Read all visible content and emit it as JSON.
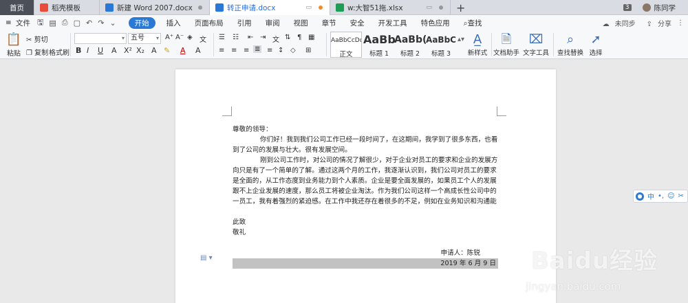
{
  "tabs": [
    {
      "label": "首页"
    },
    {
      "label": "稻壳模板",
      "icon": "docer-icon",
      "color": "#e84b3c"
    },
    {
      "label": "新建 Word 2007.docx",
      "icon": "word-doc-icon",
      "color": "#2b79d6"
    },
    {
      "label": "转正申请.docx",
      "icon": "word-doc-icon",
      "color": "#2b79d6"
    },
    {
      "label": "w:大智51拖.xlsx",
      "icon": "excel-icon",
      "color": "#1f9d55"
    }
  ],
  "tabbar_right": {
    "badge": "3",
    "user": "陈同学"
  },
  "menu": {
    "file": "文件",
    "start": "开始",
    "items": [
      "插入",
      "页面布局",
      "引用",
      "审阅",
      "视图",
      "章节",
      "安全",
      "开发工具",
      "特色应用"
    ],
    "search": "查找",
    "right": [
      "未同步",
      "分享"
    ]
  },
  "ribbon": {
    "paste": "粘贴",
    "cut": "剪切",
    "copy": "复制",
    "format_painter": "格式刷",
    "font_name": "",
    "font_size": "五号",
    "styles": [
      {
        "sample": "AaBbCcDd",
        "label": "正文"
      },
      {
        "sample": "AaBb",
        "label": "标题 1"
      },
      {
        "sample": "AaBb(",
        "label": "标题 2"
      },
      {
        "sample": "AaBbC",
        "label": "标题 3"
      }
    ],
    "new_style": "新样式",
    "doc_helper": "文档助手",
    "text_tools": "文字工具",
    "find_replace": "查找替换",
    "select": "选择"
  },
  "document": {
    "salutation": "尊敬的领导：",
    "para1": "你们好！我到我们公司工作已经一段时间了，在这期间，我学到了很多东西，也看到了公司的发展与壮大。很有发展空间。",
    "para2": "刚到公司工作时，对公司的情况了解很少，对于企业对员工的要求和企业的发展方向只是有了一个简单的了解。通过这两个月的工作，我逐渐认识到，我们公司对员工的要求是全面的，从工作态度到业务能力到个人素质。企业是要全面发展的，如果员工个人的发展跟不上企业发展的速度，那么员工将被企业淘汰。作为我们公司这样一个高成长性公司中的一员工，我有着强烈的紧迫感。在工作中我还存在着很多的不足，例如在业务知识和沟通能",
    "closing1": "此致",
    "closing2": "敬礼",
    "applicant": "申请人：陈锐",
    "date": "2019 年 6 月 9 日"
  },
  "float_toolbar": [
    "中",
    "•,"
  ],
  "watermark": {
    "brand": "Baidu经验",
    "url": "jingyan.baidu.com"
  }
}
